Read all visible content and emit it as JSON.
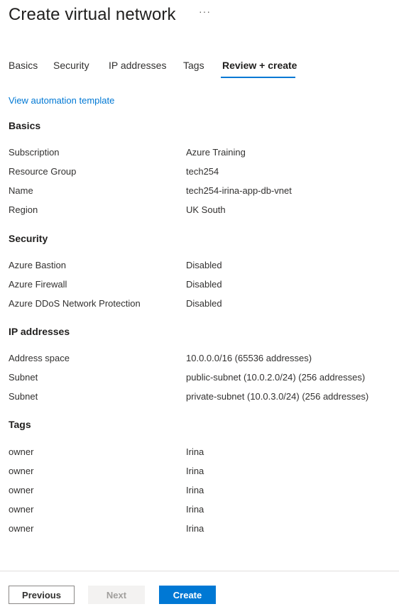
{
  "header": {
    "title": "Create virtual network",
    "more_label": "···"
  },
  "tabs": [
    {
      "label": "Basics",
      "active": false
    },
    {
      "label": "Security",
      "active": false
    },
    {
      "label": "IP addresses",
      "active": false
    },
    {
      "label": "Tags",
      "active": false
    },
    {
      "label": "Review + create",
      "active": true
    }
  ],
  "automation_link": "View automation template",
  "sections": {
    "basics": {
      "title": "Basics",
      "rows": [
        {
          "key": "Subscription",
          "value": "Azure Training"
        },
        {
          "key": "Resource Group",
          "value": "tech254"
        },
        {
          "key": "Name",
          "value": "tech254-irina-app-db-vnet"
        },
        {
          "key": "Region",
          "value": "UK South"
        }
      ]
    },
    "security": {
      "title": "Security",
      "rows": [
        {
          "key": "Azure Bastion",
          "value": "Disabled"
        },
        {
          "key": "Azure Firewall",
          "value": "Disabled"
        },
        {
          "key": "Azure DDoS Network Protection",
          "value": "Disabled"
        }
      ]
    },
    "ip": {
      "title": "IP addresses",
      "rows": [
        {
          "key": "Address space",
          "value": "10.0.0.0/16 (65536 addresses)"
        },
        {
          "key": "Subnet",
          "value": "public-subnet (10.0.2.0/24) (256 addresses)"
        },
        {
          "key": "Subnet",
          "value": "private-subnet (10.0.3.0/24) (256 addresses)"
        }
      ]
    },
    "tags": {
      "title": "Tags",
      "rows": [
        {
          "key": "owner",
          "value": "Irina"
        },
        {
          "key": "owner",
          "value": "Irina"
        },
        {
          "key": "owner",
          "value": "Irina"
        },
        {
          "key": "owner",
          "value": "Irina"
        },
        {
          "key": "owner",
          "value": "Irina"
        }
      ]
    }
  },
  "footer": {
    "previous_label": "Previous",
    "next_label": "Next",
    "create_label": "Create"
  },
  "colors": {
    "accent": "#0078d4",
    "disabled_bg": "#f3f2f1",
    "disabled_text": "#a19f9d"
  }
}
